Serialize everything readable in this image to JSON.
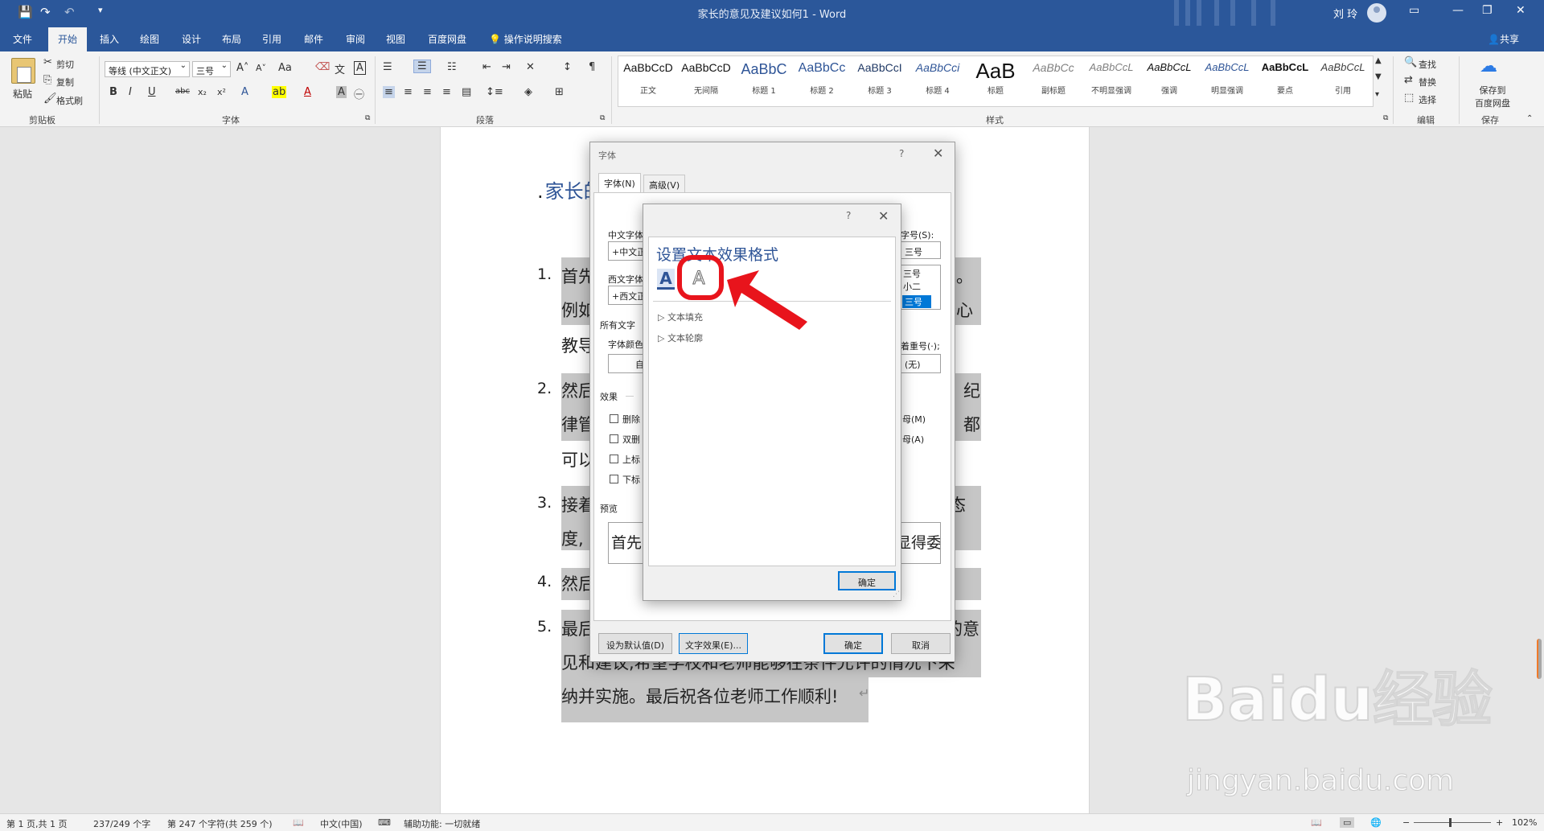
{
  "titlebar": {
    "title": "家长的意见及建议如何1 - Word",
    "user": "刘 玲",
    "minimize_icon": "—",
    "restore_icon": "❐",
    "close_icon": "✕",
    "ribbon_display_icon": "▭"
  },
  "tabs": [
    "文件",
    "开始",
    "插入",
    "绘图",
    "设计",
    "布局",
    "引用",
    "邮件",
    "审阅",
    "视图",
    "百度网盘"
  ],
  "tellme": "操作说明搜索",
  "share": "共享",
  "ribbon": {
    "clipboard": {
      "paste": "粘贴",
      "cut": "剪切",
      "copy": "复制",
      "format_painter": "格式刷",
      "label": "剪贴板"
    },
    "font": {
      "font_name": "等线 (中文正文)",
      "font_size": "三号",
      "label": "字体"
    },
    "paragraph": {
      "label": "段落"
    },
    "styles": {
      "label": "样式",
      "items": [
        {
          "preview": "AaBbCcD",
          "name": "正文"
        },
        {
          "preview": "AaBbCcD",
          "name": "无间隔"
        },
        {
          "preview": "AaBbC",
          "name": "标题 1"
        },
        {
          "preview": "AaBbCc",
          "name": "标题 2"
        },
        {
          "preview": "AaBbCcI",
          "name": "标题 3"
        },
        {
          "preview": "AaBbCci",
          "name": "标题 4"
        },
        {
          "preview": "AaB",
          "name": "标题"
        },
        {
          "preview": "AaBbCc",
          "name": "副标题"
        },
        {
          "preview": "AaBbCcL",
          "name": "不明显强调"
        },
        {
          "preview": "AaBbCcL",
          "name": "强调"
        },
        {
          "preview": "AaBbCcL",
          "name": "明显强调"
        },
        {
          "preview": "AaBbCcL",
          "name": "要点"
        },
        {
          "preview": "AaBbCcL",
          "name": "引用"
        }
      ]
    },
    "editing": {
      "find": "查找",
      "replace": "替换",
      "select": "选择",
      "label": "编辑"
    },
    "save": {
      "button": "保存到\n百度网盘",
      "line1": "保存到",
      "line2": "百度网盘",
      "label": "保存"
    }
  },
  "document": {
    "heading": "家长的",
    "items": [
      {
        "num": "1.",
        "lines": [
          "首先",
          "例如",
          "教导"
        ],
        "right": [
          "兑。",
          "公心",
          ""
        ]
      },
      {
        "num": "2.",
        "lines": [
          "然后",
          "律管",
          "可以"
        ],
        "right": [
          "纪",
          "都",
          ""
        ]
      },
      {
        "num": "3.",
        "lines": [
          "接着",
          "度,"
        ],
        "right": [
          "态",
          ""
        ]
      },
      {
        "num": "4.",
        "lines": [
          "然后"
        ],
        "right": [
          ""
        ]
      },
      {
        "num": "5.",
        "lines": [
          "最后"
        ],
        "right": [
          "的意"
        ]
      }
    ],
    "line_item5_2": "见和建议,希望学校和老师能够在条件允许的情况下采",
    "line_item5_3": "纳并实施。最后祝各位老师工作顺利!"
  },
  "font_dialog": {
    "title": "字体",
    "help": "?",
    "tab_font": "字体(N)",
    "tab_advanced": "高级(V)",
    "cn_font_label": "中文字体",
    "cn_font_value": "+中文正",
    "west_font_label": "西文字体",
    "west_font_value": "+西文正",
    "size_label": "字号(S):",
    "size_value": "三号",
    "size_list": [
      "三号",
      "小二",
      "三号"
    ],
    "all_text": "所有文字",
    "font_color_label": "字体颜色",
    "font_color_value": "自",
    "emphasis_label": "着重号(·);",
    "emphasis_value": "(无)",
    "effects": "效果",
    "strike": "删除",
    "double_strike": "双删",
    "superscript": "上标",
    "subscript": "下标",
    "small_caps": "母(M)",
    "all_caps": "母(A)",
    "preview_label": "预览",
    "preview_text": "首先",
    "preview_right": "显得委",
    "set_default": "设为默认值(D)",
    "text_effects": "文字效果(E)...",
    "ok": "确定",
    "cancel": "取消"
  },
  "fx_dialog": {
    "help": "?",
    "title": "设置文本效果格式",
    "icon_fill": "A",
    "icon_outline": "A",
    "text_fill": "文本填充",
    "text_outline": "文本轮廓",
    "ok": "确定"
  },
  "status": {
    "page": "第 1 页,共 1 页",
    "words": "237/249 个字",
    "chars": "第 247 个字符(共 259 个)",
    "lang": "中文(中国)",
    "accessibility": "辅助功能: 一切就绪",
    "zoom": "102%"
  },
  "watermark": {
    "brand": "Baidu经验",
    "url": "jingyan.baidu.com"
  },
  "colors": {
    "brand": "#2b579a",
    "annotation": "#e8141c",
    "heading": "#2f5597"
  }
}
